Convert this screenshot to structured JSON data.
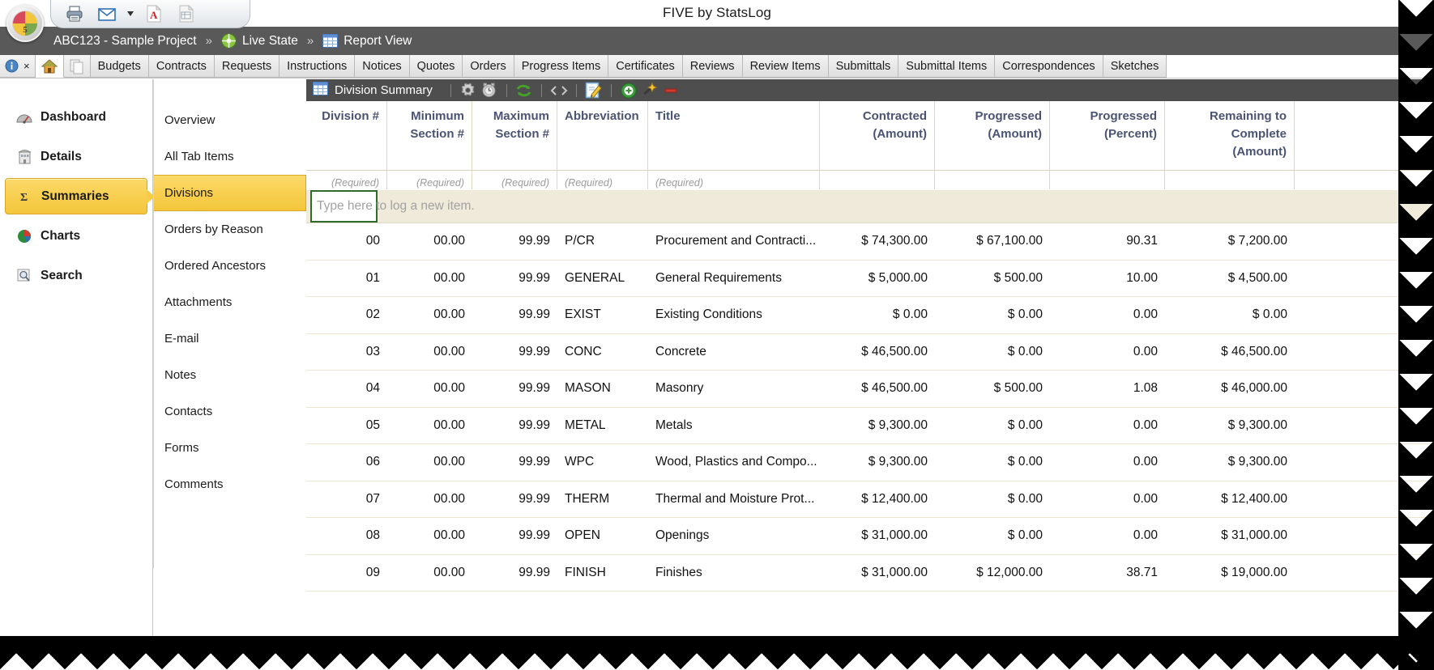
{
  "app": {
    "title": "FIVE by StatsLog"
  },
  "quick_access": {
    "buttons": [
      {
        "name": "print-icon",
        "label": "Print"
      },
      {
        "name": "email-icon",
        "label": "E-mail"
      },
      {
        "name": "email-dropdown-caret",
        "label": "▾"
      },
      {
        "name": "pdf-icon",
        "label": "Export to PDF"
      },
      {
        "name": "excel-icon",
        "label": "Export to Excel"
      }
    ]
  },
  "breadcrumb": {
    "project": "ABC123 - Sample Project",
    "sep1": "»",
    "state": "Live State",
    "sep2": "»",
    "view": "Report View"
  },
  "tabs": {
    "system": [
      {
        "name": "info-tab",
        "label": ""
      },
      {
        "name": "close-tab",
        "label": "×"
      },
      {
        "name": "home-tab",
        "label": ""
      },
      {
        "name": "copy-tab",
        "label": ""
      }
    ],
    "items": [
      "Budgets",
      "Contracts",
      "Requests",
      "Instructions",
      "Notices",
      "Quotes",
      "Orders",
      "Progress Items",
      "Certificates",
      "Reviews",
      "Review Items",
      "Submittals",
      "Submittal Items",
      "Correspondences",
      "Sketches"
    ]
  },
  "sidebar": {
    "items": [
      {
        "label": "Dashboard",
        "icon": "gauge-icon",
        "selected": false
      },
      {
        "label": "Details",
        "icon": "building-icon",
        "selected": false
      },
      {
        "label": "Summaries",
        "icon": "sigma-icon",
        "selected": true
      },
      {
        "label": "Charts",
        "icon": "pie-chart-icon",
        "selected": false
      },
      {
        "label": "Search",
        "icon": "magnifier-icon",
        "selected": false
      }
    ]
  },
  "subnav": {
    "items": [
      {
        "label": "Overview",
        "selected": false
      },
      {
        "label": "All Tab Items",
        "selected": false
      },
      {
        "label": "Divisions",
        "selected": true
      },
      {
        "label": "Orders by Reason",
        "selected": false
      },
      {
        "label": "Ordered Ancestors",
        "selected": false
      },
      {
        "label": "Attachments",
        "selected": false
      },
      {
        "label": "E-mail",
        "selected": false
      },
      {
        "label": "Notes",
        "selected": false
      },
      {
        "label": "Contacts",
        "selected": false
      },
      {
        "label": "Forms",
        "selected": false
      },
      {
        "label": "Comments",
        "selected": false
      }
    ]
  },
  "toolbar": {
    "title": "Division Summary",
    "buttons": [
      {
        "name": "settings-gear-icon",
        "label": "Settings"
      },
      {
        "name": "clock-icon",
        "label": "History"
      },
      {
        "name": "refresh-icon",
        "label": "Refresh"
      },
      {
        "name": "code-icon",
        "label": "Code"
      },
      {
        "name": "edit-pencil-icon",
        "label": "Edit"
      },
      {
        "name": "add-circle-icon",
        "label": "Add"
      },
      {
        "name": "wand-icon",
        "label": "Wizard"
      },
      {
        "name": "remove-icon",
        "label": "Remove"
      }
    ]
  },
  "grid": {
    "columns": [
      {
        "key": "division",
        "header": "Division #",
        "align": "r",
        "required": "(Required)",
        "cls": "c0"
      },
      {
        "key": "min_sec",
        "header": "Minimum\nSection #",
        "align": "r",
        "required": "(Required)",
        "cls": "c1"
      },
      {
        "key": "max_sec",
        "header": "Maximum\nSection #",
        "align": "r",
        "required": "(Required)",
        "cls": "c2"
      },
      {
        "key": "abbrev",
        "header": "Abbreviation",
        "align": "l",
        "required": "(Required)",
        "cls": "c3"
      },
      {
        "key": "title",
        "header": "Title",
        "align": "l",
        "required": "(Required)",
        "cls": "c4"
      },
      {
        "key": "contracted",
        "header": "Contracted\n(Amount)",
        "align": "r",
        "required": "",
        "cls": "c5"
      },
      {
        "key": "prog_amt",
        "header": "Progressed\n(Amount)",
        "align": "r",
        "required": "",
        "cls": "c6"
      },
      {
        "key": "prog_pct",
        "header": "Progressed\n(Percent)",
        "align": "r",
        "required": "",
        "cls": "c7"
      },
      {
        "key": "remaining",
        "header": "Remaining to\nComplete\n(Amount)",
        "align": "r",
        "required": "",
        "cls": "c8"
      }
    ],
    "new_item_placeholder": "Type here to log a new item.",
    "rows": [
      {
        "division": "00",
        "min_sec": "00.00",
        "max_sec": "99.99",
        "abbrev": "P/CR",
        "title": "Procurement and Contracti...",
        "contracted": "$ 74,300.00",
        "prog_amt": "$ 67,100.00",
        "prog_pct": "90.31",
        "remaining": "$ 7,200.00"
      },
      {
        "division": "01",
        "min_sec": "00.00",
        "max_sec": "99.99",
        "abbrev": "GENERAL",
        "title": "General Requirements",
        "contracted": "$ 5,000.00",
        "prog_amt": "$ 500.00",
        "prog_pct": "10.00",
        "remaining": "$ 4,500.00"
      },
      {
        "division": "02",
        "min_sec": "00.00",
        "max_sec": "99.99",
        "abbrev": "EXIST",
        "title": "Existing Conditions",
        "contracted": "$ 0.00",
        "prog_amt": "$ 0.00",
        "prog_pct": "0.00",
        "remaining": "$ 0.00"
      },
      {
        "division": "03",
        "min_sec": "00.00",
        "max_sec": "99.99",
        "abbrev": "CONC",
        "title": "Concrete",
        "contracted": "$ 46,500.00",
        "prog_amt": "$ 0.00",
        "prog_pct": "0.00",
        "remaining": "$ 46,500.00"
      },
      {
        "division": "04",
        "min_sec": "00.00",
        "max_sec": "99.99",
        "abbrev": "MASON",
        "title": "Masonry",
        "contracted": "$ 46,500.00",
        "prog_amt": "$ 500.00",
        "prog_pct": "1.08",
        "remaining": "$ 46,000.00"
      },
      {
        "division": "05",
        "min_sec": "00.00",
        "max_sec": "99.99",
        "abbrev": "METAL",
        "title": "Metals",
        "contracted": "$ 9,300.00",
        "prog_amt": "$ 0.00",
        "prog_pct": "0.00",
        "remaining": "$ 9,300.00"
      },
      {
        "division": "06",
        "min_sec": "00.00",
        "max_sec": "99.99",
        "abbrev": "WPC",
        "title": "Wood, Plastics and Compo...",
        "contracted": "$ 9,300.00",
        "prog_amt": "$ 0.00",
        "prog_pct": "0.00",
        "remaining": "$ 9,300.00"
      },
      {
        "division": "07",
        "min_sec": "00.00",
        "max_sec": "99.99",
        "abbrev": "THERM",
        "title": "Thermal and Moisture Prot...",
        "contracted": "$ 12,400.00",
        "prog_amt": "$ 0.00",
        "prog_pct": "0.00",
        "remaining": "$ 12,400.00"
      },
      {
        "division": "08",
        "min_sec": "00.00",
        "max_sec": "99.99",
        "abbrev": "OPEN",
        "title": "Openings",
        "contracted": "$ 31,000.00",
        "prog_amt": "$ 0.00",
        "prog_pct": "0.00",
        "remaining": "$ 31,000.00"
      },
      {
        "division": "09",
        "min_sec": "00.00",
        "max_sec": "99.99",
        "abbrev": "FINISH",
        "title": "Finishes",
        "contracted": "$ 31,000.00",
        "prog_amt": "$ 12,000.00",
        "prog_pct": "38.71",
        "remaining": "$ 19,000.00"
      }
    ]
  },
  "colors": {
    "accent_yellow": "#f6cb46",
    "toolbar_dark": "#4e4e4e",
    "header_text": "#4a5472",
    "new_row_bg": "#efeada"
  }
}
